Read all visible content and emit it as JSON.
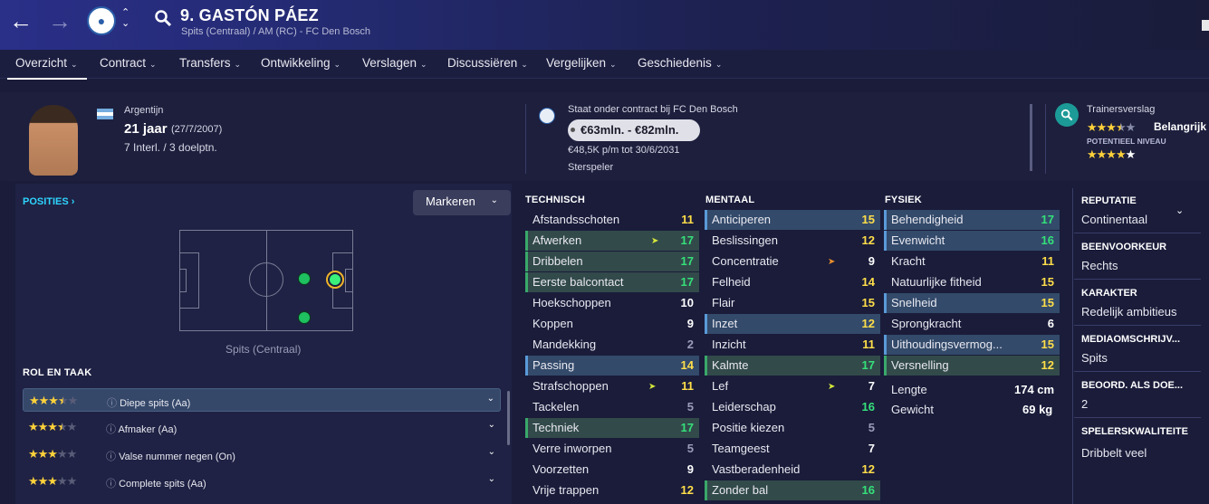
{
  "header": {
    "player_name": "9. GASTÓN PÁEZ",
    "subtitle": "Spits (Centraal) / AM (RC) - FC Den Bosch"
  },
  "tabs": [
    {
      "label": "Overzicht"
    },
    {
      "label": "Contract"
    },
    {
      "label": "Transfers"
    },
    {
      "label": "Ontwikkeling"
    },
    {
      "label": "Verslagen"
    },
    {
      "label": "Discussiëren"
    },
    {
      "label": "Vergelijken"
    },
    {
      "label": "Geschiedenis"
    }
  ],
  "profile": {
    "nationality": "Argentijn",
    "age": "21 jaar",
    "dob": "(27/7/2007)",
    "caps": "7 Interl. / 3 doelptn."
  },
  "contract": {
    "status": "Staat onder contract bij FC Den Bosch",
    "value": "€63mln. - €82mln.",
    "wage": "€48,5K p/m tot 30/6/2031",
    "role": "Sterspeler"
  },
  "coach_report": {
    "title": "Trainersverslag",
    "importance": "Belangrijk",
    "potential_label": "POTENTIEEL NIVEAU",
    "current_stars": 3.5,
    "potential_stars": 4.5
  },
  "positions": {
    "title": "POSITIES",
    "filter_button": "Markeren",
    "position_label": "Spits (Centraal)"
  },
  "roles": {
    "title": "ROL EN TAAK",
    "items": [
      {
        "name": "Diepe spits (Aa)",
        "stars": 3.5
      },
      {
        "name": "Afmaker (Aa)",
        "stars": 3.5
      },
      {
        "name": "Valse nummer negen (On)",
        "stars": 3
      },
      {
        "name": "Complete spits (Aa)",
        "stars": 3
      }
    ]
  },
  "attributes": {
    "technical_title": "TECHNISCH",
    "mental_title": "MENTAAL",
    "physical_title": "FYSIEK",
    "technical": [
      {
        "name": "Afstandsschoten",
        "value": "11"
      },
      {
        "name": "Afwerken",
        "value": "17"
      },
      {
        "name": "Dribbelen",
        "value": "17"
      },
      {
        "name": "Eerste balcontact",
        "value": "17"
      },
      {
        "name": "Hoekschoppen",
        "value": "10"
      },
      {
        "name": "Koppen",
        "value": "9"
      },
      {
        "name": "Mandekking",
        "value": "2"
      },
      {
        "name": "Passing",
        "value": "14"
      },
      {
        "name": "Strafschoppen",
        "value": "11"
      },
      {
        "name": "Tackelen",
        "value": "5"
      },
      {
        "name": "Techniek",
        "value": "17"
      },
      {
        "name": "Verre inworpen",
        "value": "5"
      },
      {
        "name": "Voorzetten",
        "value": "9"
      },
      {
        "name": "Vrije trappen",
        "value": "12"
      }
    ],
    "mental": [
      {
        "name": "Anticiperen",
        "value": "15"
      },
      {
        "name": "Beslissingen",
        "value": "12"
      },
      {
        "name": "Concentratie",
        "value": "9"
      },
      {
        "name": "Felheid",
        "value": "14"
      },
      {
        "name": "Flair",
        "value": "15"
      },
      {
        "name": "Inzet",
        "value": "12"
      },
      {
        "name": "Inzicht",
        "value": "11"
      },
      {
        "name": "Kalmte",
        "value": "17"
      },
      {
        "name": "Lef",
        "value": "7"
      },
      {
        "name": "Leiderschap",
        "value": "16"
      },
      {
        "name": "Positie kiezen",
        "value": "5"
      },
      {
        "name": "Teamgeest",
        "value": "7"
      },
      {
        "name": "Vastberadenheid",
        "value": "12"
      },
      {
        "name": "Zonder bal",
        "value": "16"
      }
    ],
    "physical": [
      {
        "name": "Behendigheid",
        "value": "17"
      },
      {
        "name": "Evenwicht",
        "value": "16"
      },
      {
        "name": "Kracht",
        "value": "11"
      },
      {
        "name": "Natuurlijke fitheid",
        "value": "15"
      },
      {
        "name": "Snelheid",
        "value": "15"
      },
      {
        "name": "Sprongkracht",
        "value": "6"
      },
      {
        "name": "Uithoudingsvermog...",
        "value": "15"
      },
      {
        "name": "Versnelling",
        "value": "12"
      }
    ],
    "length_label": "Lengte",
    "length": "174 cm",
    "weight_label": "Gewicht",
    "weight": "69 kg"
  },
  "sidebar": [
    {
      "label": "REPUTATIE",
      "value": "Continentaal"
    },
    {
      "label": "BEENVOORKEUR",
      "value": "Rechts"
    },
    {
      "label": "KARAKTER",
      "value": "Redelijk ambitieus"
    },
    {
      "label": "MEDIAOMSCHRIJV...",
      "value": "Spits"
    },
    {
      "label": "BEOORD. ALS DOE...",
      "value": "2"
    },
    {
      "label": "SPELERSKWALITEITE",
      "value": "Dribbelt veel"
    }
  ],
  "colors": {
    "accent": "#2ed4ff",
    "good": "#35e07a",
    "mid": "#ffde4a"
  }
}
